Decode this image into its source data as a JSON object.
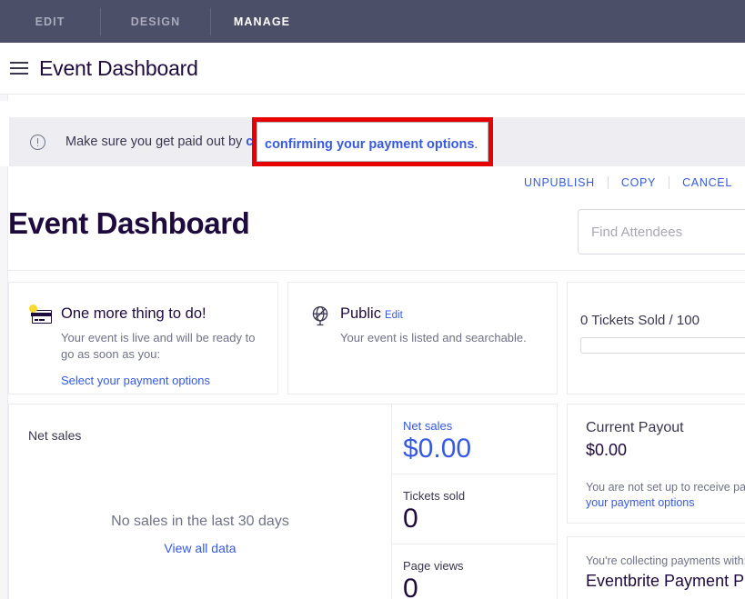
{
  "topnav": {
    "items": [
      {
        "label": "EDIT",
        "active": false
      },
      {
        "label": "DESIGN",
        "active": false
      },
      {
        "label": "MANAGE",
        "active": true
      }
    ]
  },
  "header": {
    "menu_icon": "hamburger-icon",
    "title": "Event Dashboard"
  },
  "banner": {
    "icon": "info-circle-icon",
    "text": "Make sure you get paid out by ",
    "link_text": "confirming your payment options",
    "period": "."
  },
  "annotation": {
    "color": "#e60000",
    "highlighted_text": "confirming your payment options",
    "period": "."
  },
  "actions": [
    {
      "label": "UNPUBLISH"
    },
    {
      "label": "COPY"
    },
    {
      "label": "CANCEL"
    }
  ],
  "page": {
    "title": "Event Dashboard"
  },
  "search": {
    "placeholder": "Find Attendees",
    "value": ""
  },
  "cards": {
    "todo": {
      "icon": "credit-card-icon",
      "badge_color": "#f8d92f",
      "title": "One more thing to do!",
      "body": "Your event is live and will be ready to go as soon as you:",
      "link": "Select your payment options"
    },
    "visibility": {
      "icon": "globe-icon",
      "title": "Public",
      "edit_label": "Edit",
      "body": "Your event is listed and searchable."
    },
    "tickets": {
      "label": "0 Tickets Sold / 100",
      "sold": 0,
      "capacity": 100,
      "progress_percent": 0
    }
  },
  "netsales": {
    "label": "Net sales",
    "empty_message": "No sales in the last 30 days",
    "view_all_label": "View all data"
  },
  "stats": [
    {
      "label": "Net sales",
      "value": "$0.00"
    },
    {
      "label": "Tickets sold",
      "value": "0"
    },
    {
      "label": "Page views",
      "value": "0"
    }
  ],
  "payout": {
    "title": "Current Payout",
    "value": "$0.00",
    "note": "You are not set up to receive payouts.",
    "link": "your payment options"
  },
  "processor": {
    "label": "You're collecting payments with:",
    "name": "Eventbrite Payment Processing"
  },
  "chart_data": {
    "type": "line",
    "title": "Net sales",
    "x": [],
    "values": [],
    "xlabel": "",
    "ylabel": "Net sales",
    "annotation": "No sales in the last 30 days",
    "period_days": 30,
    "grid": false,
    "legend": "none"
  }
}
